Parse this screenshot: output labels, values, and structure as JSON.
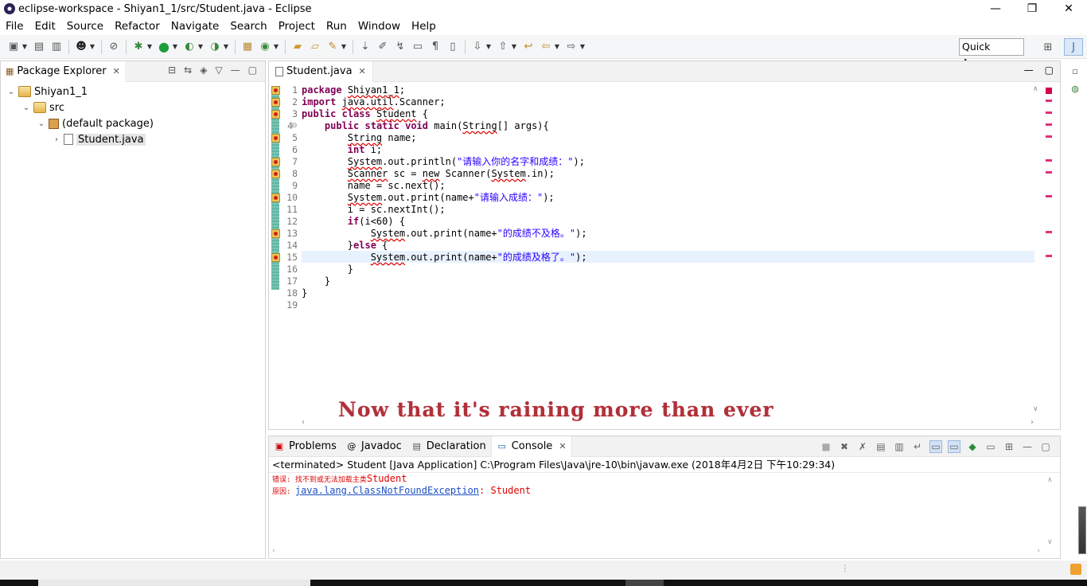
{
  "window": {
    "title": "eclipse-workspace - Shiyan1_1/src/Student.java - Eclipse",
    "controls": {
      "minimize": "—",
      "restore": "❐",
      "close": "✕"
    }
  },
  "menu": [
    "File",
    "Edit",
    "Source",
    "Refactor",
    "Navigate",
    "Search",
    "Project",
    "Run",
    "Window",
    "Help"
  ],
  "toolbar": {
    "quick_access": "Quick Access"
  },
  "package_explorer": {
    "tab_label": "Package Explorer",
    "tree": [
      {
        "label": "Shiyan1_1",
        "icon": "project-icon",
        "level": 0,
        "expanded": true
      },
      {
        "label": "src",
        "icon": "source-folder-icon",
        "level": 1,
        "expanded": true
      },
      {
        "label": "(default package)",
        "icon": "package-icon",
        "level": 2,
        "expanded": true
      },
      {
        "label": "Student.java",
        "icon": "java-file-icon",
        "level": 3,
        "expanded": false,
        "selected": true
      }
    ]
  },
  "editor": {
    "tab_label": "Student.java",
    "highlighted_line": 15,
    "line_numbers": [
      "1",
      "2",
      "3",
      "4",
      "5",
      "6",
      "7",
      "8",
      "9",
      "10",
      "11",
      "12",
      "13",
      "14",
      "15",
      "16",
      "17",
      "18",
      "19"
    ],
    "error_lines": [
      1,
      2,
      3,
      4,
      5,
      7,
      8,
      10,
      13,
      15
    ]
  },
  "subtitle": "Now that it's raining more than ever",
  "console_view": {
    "tabs": [
      "Problems",
      "Javadoc",
      "Declaration",
      "Console"
    ],
    "active_tab": "Console",
    "terminated": "<terminated> Student [Java Application] C:\\Program Files\\Java\\jre-10\\bin\\javaw.exe (2018年4月2日 下午10:29:34)",
    "line1_prefix": "错误: 找不到或无法加载主类",
    "line1_class": "Student",
    "line2_prefix": "原因: ",
    "line2_link": "java.lang.ClassNotFoundException",
    "line2_suffix": ": Student"
  },
  "colors": {
    "keyword": "#7f0055",
    "string": "#2a00ff",
    "error_output": "#e00000",
    "link": "#1a4fc4",
    "current_line": "#e8f2fe",
    "subtitle": "#b0303a"
  }
}
